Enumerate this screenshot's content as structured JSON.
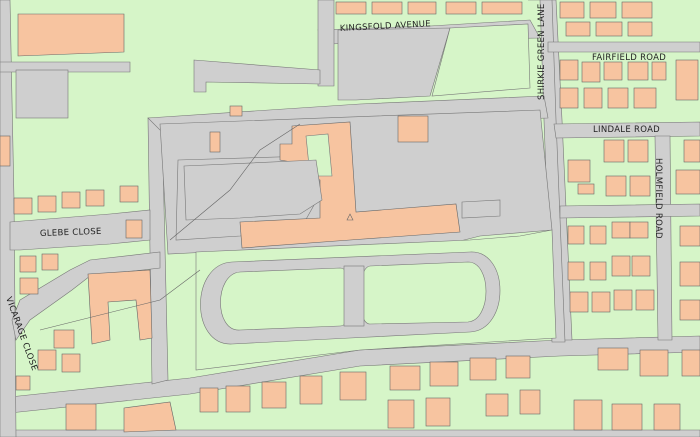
{
  "colors": {
    "grass": "#d6f5c8",
    "road": "#cfcfcf",
    "building": "#f7c4a0",
    "outline": "#666666",
    "path": "#b88060",
    "marker": "#6aa6d8"
  },
  "labels": {
    "kingsfold_avenue": "KINGSFOLD AVENUE",
    "fairfield_road": "FAIRFIELD ROAD",
    "lindale_road": "LINDALE ROAD",
    "holmfield_road": "HOLMFIELD ROAD",
    "shirkie_green_lane": "SHIRKIE GREEN LANE",
    "glebe_close": "GLEBE CLOSE",
    "vicarage_close": "VICARAGE CLOSE"
  }
}
